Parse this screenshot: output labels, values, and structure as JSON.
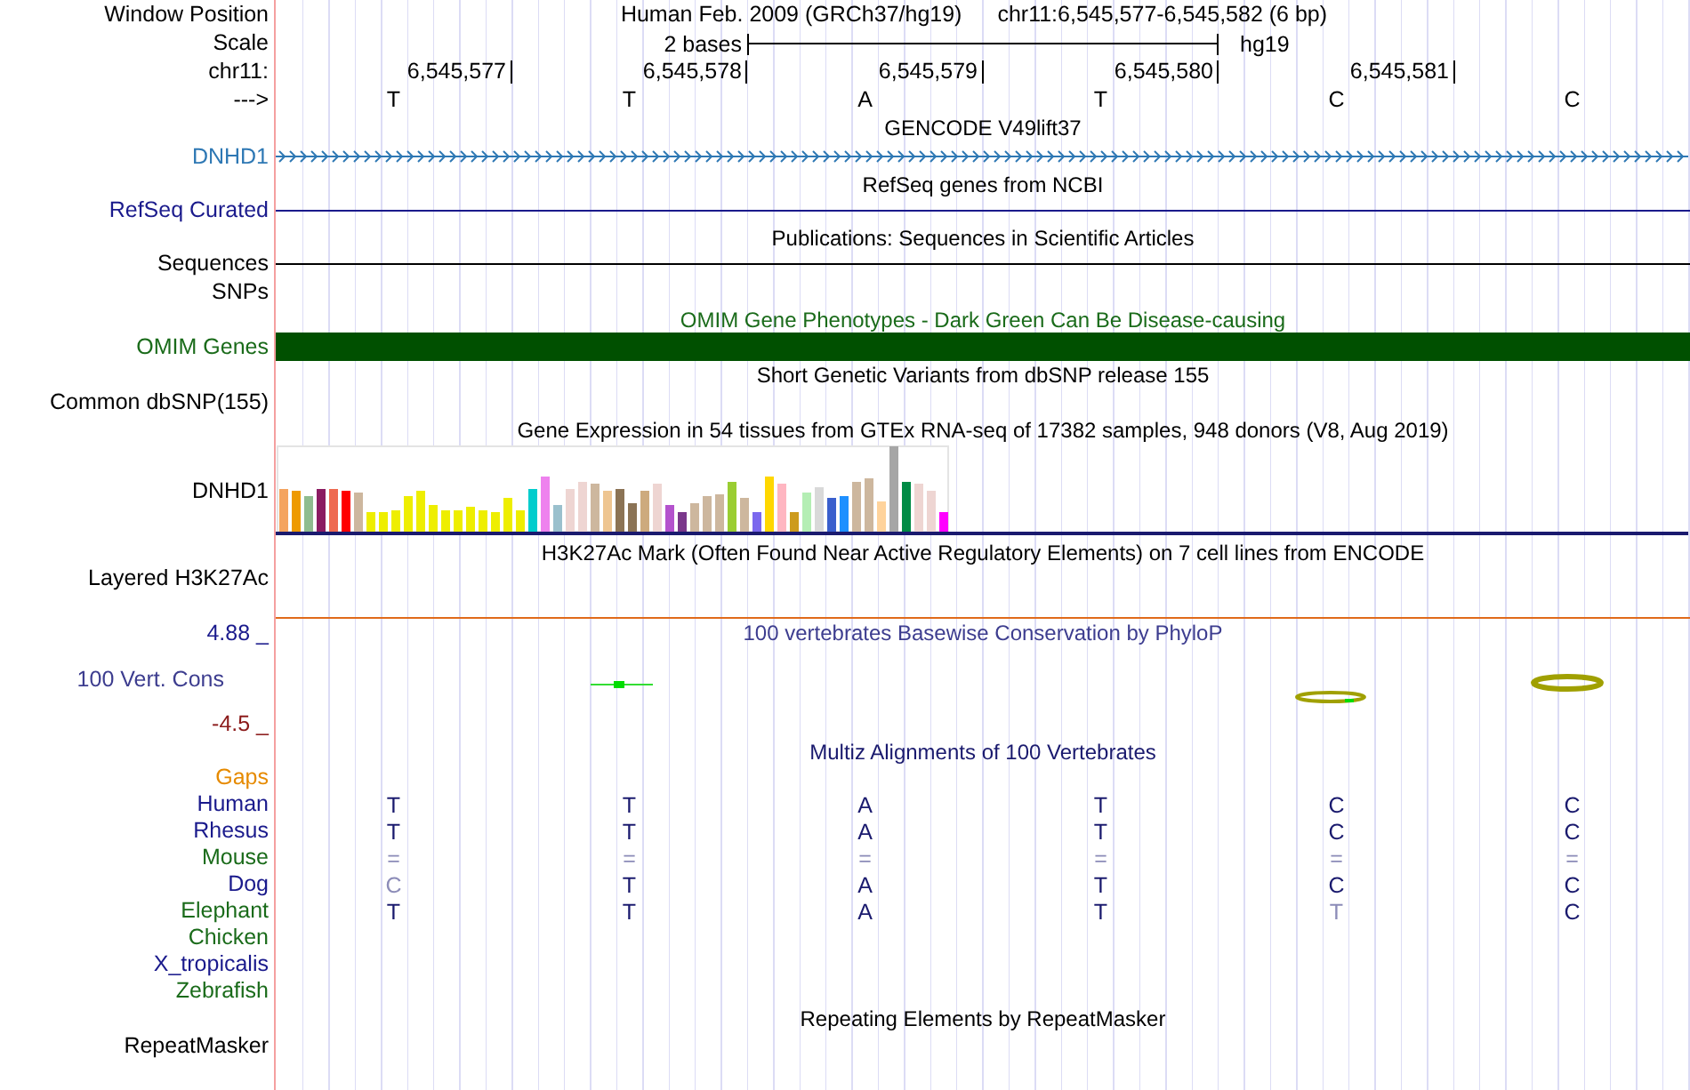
{
  "header": {
    "window_position_label": "Window Position",
    "scale_label": "Scale",
    "chromosome_label": "chr11:",
    "strand_label": "--->",
    "assembly": "Human Feb. 2009 (GRCh37/hg19)",
    "position": "chr11:6,545,577-6,545,582 (6 bp)",
    "scale_text": "2 bases",
    "scale_db": "hg19",
    "ticks": [
      "6,545,577",
      "6,545,578",
      "6,545,579",
      "6,545,580",
      "6,545,581"
    ],
    "bases": [
      "T",
      "T",
      "A",
      "T",
      "C",
      "C"
    ]
  },
  "tracks": [
    {
      "kind": "gene",
      "title": {
        "text": "GENCODE V49lift37",
        "color": "#000000"
      },
      "labels": [
        "DNHD1"
      ],
      "color": "#2e78b4"
    },
    {
      "kind": "line",
      "title": {
        "text": "RefSeq genes from NCBI",
        "color": "#000000"
      },
      "labels": [
        "RefSeq Curated"
      ],
      "color": "#1a1a8c"
    },
    {
      "kind": "line",
      "title": {
        "text": "Publications: Sequences in Scientific Articles",
        "color": "#000000"
      },
      "labels": [
        "Sequences",
        "SNPs"
      ],
      "color": "#000000"
    },
    {
      "kind": "bar",
      "title": {
        "text": "OMIM Gene Phenotypes - Dark Green Can Be Disease-causing",
        "color": "#1a6b1a"
      },
      "labels": [
        "OMIM Genes"
      ],
      "color": "#1a6b1a"
    },
    {
      "kind": "plain",
      "title": {
        "text": "Short Genetic Variants from dbSNP release 155",
        "color": "#000000"
      },
      "labels": [
        "Common dbSNP(155)"
      ],
      "color": "#000000"
    },
    {
      "kind": "expression",
      "title": {
        "text": "Gene Expression in 54 tissues from GTEx RNA-seq of 17382 samples, 948 donors (V8, Aug 2019)",
        "color": "#000000"
      },
      "labels": [
        "DNHD1"
      ],
      "color": "#000000"
    },
    {
      "kind": "signal",
      "title": {
        "text": "H3K27Ac Mark (Often Found Near Active Regulatory Elements) on 7 cell lines from ENCODE",
        "color": "#000000"
      },
      "labels": [
        "Layered H3K27Ac"
      ],
      "color": "#000000"
    },
    {
      "kind": "conservation",
      "title": {
        "text": "100 vertebrates Basewise Conservation by PhyloP",
        "color": "#3d3d8f"
      },
      "labels": [
        "4.88 _",
        "100 Vert. Cons",
        "-4.5 _"
      ],
      "color": "#3d3d8f"
    },
    {
      "kind": "alignment",
      "title": {
        "text": "Multiz Alignments of 100 Vertebrates",
        "color": "#1a1a6e"
      },
      "species": [
        {
          "name": "Gaps",
          "color": "#e68a00"
        },
        {
          "name": "Human",
          "color": "#1a1a8c",
          "bases": [
            {
              "text": "T",
              "faded": false
            },
            {
              "text": "T",
              "faded": false
            },
            {
              "text": "A",
              "faded": false
            },
            {
              "text": "T",
              "faded": false
            },
            {
              "text": "C",
              "faded": false
            },
            {
              "text": "C",
              "faded": false
            }
          ]
        },
        {
          "name": "Rhesus",
          "color": "#1a1a8c",
          "bases": [
            {
              "text": "T",
              "faded": false
            },
            {
              "text": "T",
              "faded": false
            },
            {
              "text": "A",
              "faded": false
            },
            {
              "text": "T",
              "faded": false
            },
            {
              "text": "C",
              "faded": false
            },
            {
              "text": "C",
              "faded": false
            }
          ]
        },
        {
          "name": "Mouse",
          "color": "#1a6b1a",
          "bases": [
            {
              "text": "=",
              "faded": true
            },
            {
              "text": "=",
              "faded": true
            },
            {
              "text": "=",
              "faded": true
            },
            {
              "text": "=",
              "faded": true
            },
            {
              "text": "=",
              "faded": true
            },
            {
              "text": "=",
              "faded": true
            }
          ]
        },
        {
          "name": "Dog",
          "color": "#1a1a8c",
          "bases": [
            {
              "text": "C",
              "faded": true
            },
            {
              "text": "T",
              "faded": false
            },
            {
              "text": "A",
              "faded": false
            },
            {
              "text": "T",
              "faded": false
            },
            {
              "text": "C",
              "faded": false
            },
            {
              "text": "C",
              "faded": false
            }
          ]
        },
        {
          "name": "Elephant",
          "color": "#1a6b1a",
          "bases": [
            {
              "text": "T",
              "faded": false
            },
            {
              "text": "T",
              "faded": false
            },
            {
              "text": "A",
              "faded": false
            },
            {
              "text": "T",
              "faded": false
            },
            {
              "text": "T",
              "faded": true
            },
            {
              "text": "C",
              "faded": false
            }
          ]
        },
        {
          "name": "Chicken",
          "color": "#1a6b1a"
        },
        {
          "name": "X_tropicalis",
          "color": "#1a1a8c"
        },
        {
          "name": "Zebrafish",
          "color": "#1a6b1a"
        }
      ]
    },
    {
      "kind": "plain",
      "title": {
        "text": "Repeating Elements by RepeatMasker",
        "color": "#000000"
      },
      "labels": [
        "RepeatMasker"
      ],
      "color": "#000000"
    }
  ]
}
